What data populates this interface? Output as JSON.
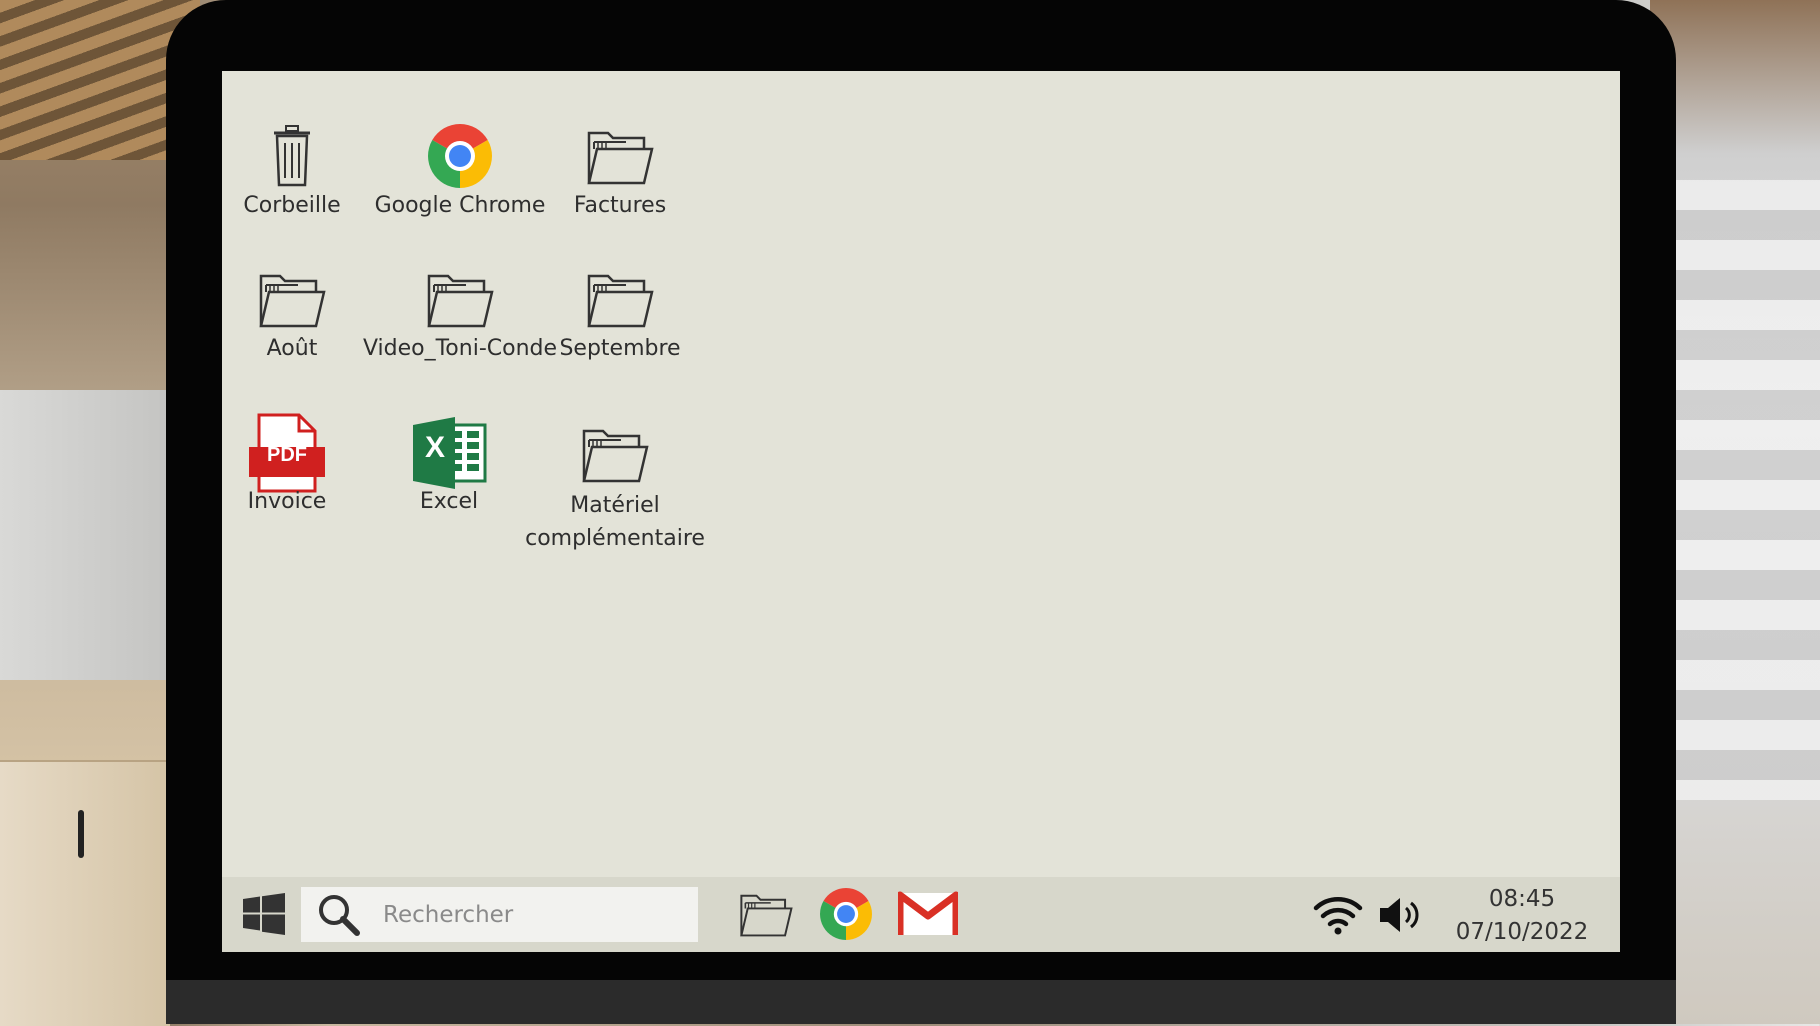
{
  "desktop": {
    "icons": [
      {
        "label": "Corbeille",
        "icon": "trash-icon"
      },
      {
        "label": "Google Chrome",
        "icon": "chrome-icon"
      },
      {
        "label": "Factures",
        "icon": "folder-icon"
      },
      {
        "label": "Août",
        "icon": "folder-icon"
      },
      {
        "label": "Video_Toni-Conde",
        "icon": "folder-icon"
      },
      {
        "label": "Septembre",
        "icon": "folder-icon"
      },
      {
        "label": "Invoice",
        "icon": "pdf-icon",
        "badge": "PDF"
      },
      {
        "label": "Excel",
        "icon": "excel-icon",
        "badge": "X"
      },
      {
        "label": "Matériel complémentaire",
        "icon": "folder-icon"
      }
    ]
  },
  "taskbar": {
    "search_placeholder": "Rechercher",
    "pinned": [
      "file-explorer-icon",
      "chrome-icon",
      "gmail-icon"
    ],
    "time": "08:45",
    "date": "07/10/2022"
  },
  "colors": {
    "screen_bg": "#e3e3d8",
    "taskbar_bg": "#d7d7cb",
    "pdf_red": "#d0201f",
    "excel_green": "#1f7a45",
    "gmail_red": "#d93025"
  }
}
